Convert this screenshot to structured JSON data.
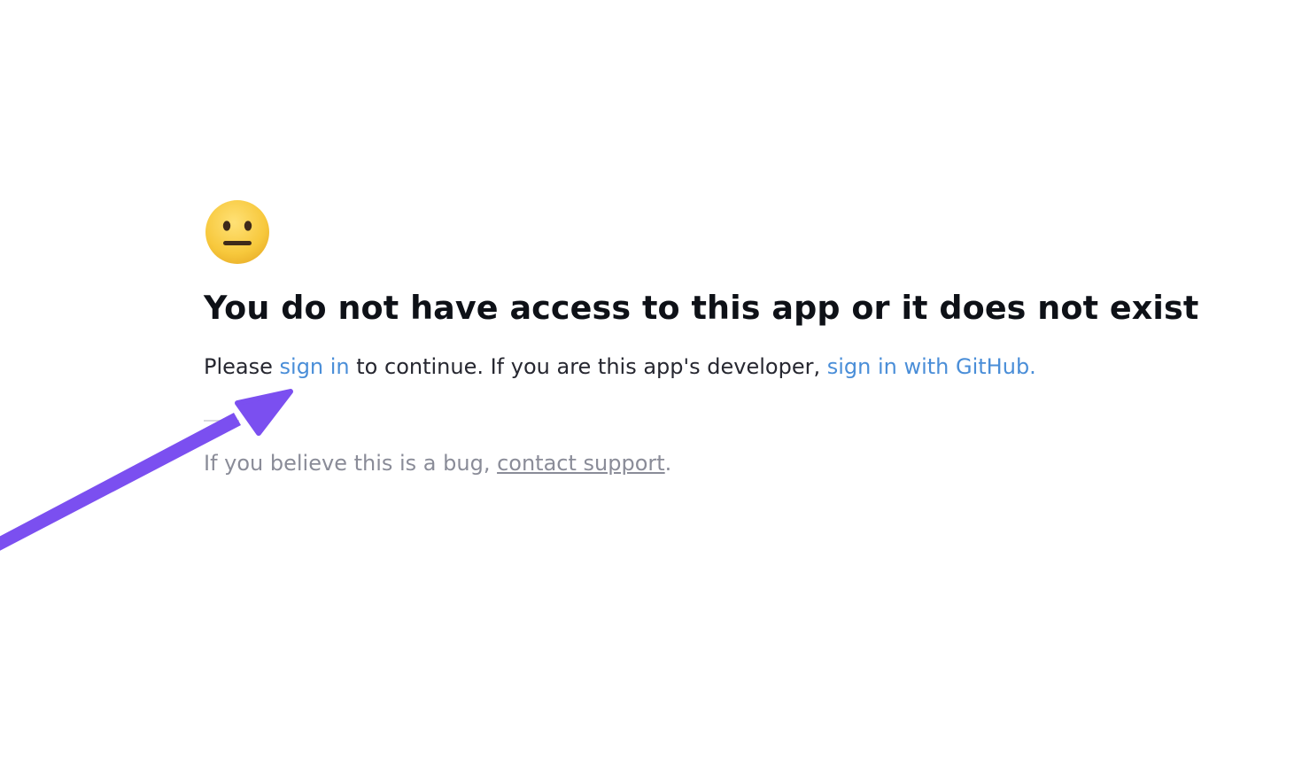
{
  "error": {
    "emoji": "neutral-face-icon",
    "heading": "You do not have access to this app or it does not exist",
    "message": {
      "prefix": "Please ",
      "sign_in_link": "sign in",
      "middle": " to continue. If you are this app's developer, ",
      "github_link": "sign in with GitHub."
    },
    "support": {
      "prefix": "If you believe this is a bug, ",
      "link": "contact support",
      "suffix": "."
    }
  },
  "annotation": {
    "arrow_icon": "arrow-pointer-icon",
    "arrow_color": "#7b4ff0"
  },
  "colors": {
    "link": "#4a8ed8",
    "heading": "#0e1117",
    "body_text": "#262730",
    "muted_text": "#8a8c98",
    "emoji_yellow": "#f5c63a"
  }
}
